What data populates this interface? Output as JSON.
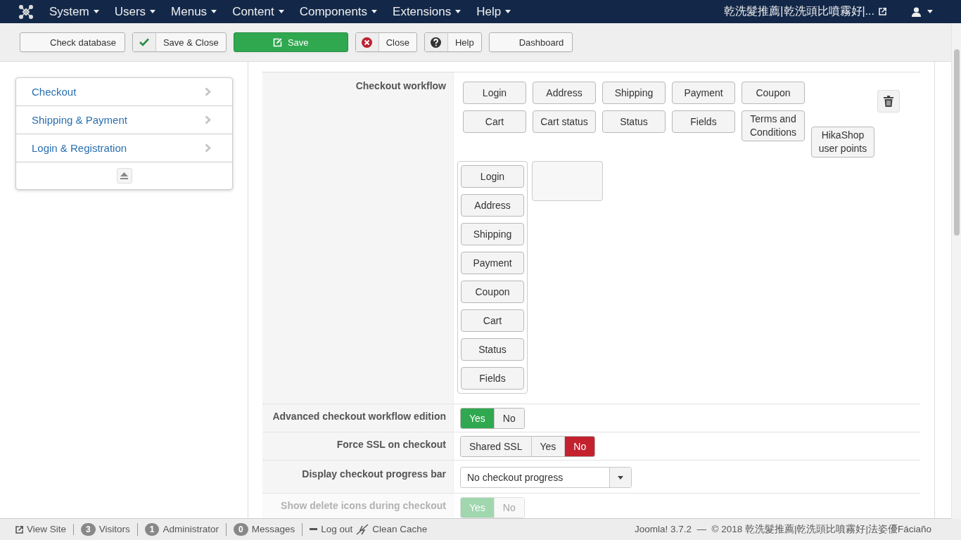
{
  "navbar": {
    "menus": [
      {
        "label": "System"
      },
      {
        "label": "Users"
      },
      {
        "label": "Menus"
      },
      {
        "label": "Content"
      },
      {
        "label": "Components"
      },
      {
        "label": "Extensions"
      },
      {
        "label": "Help"
      }
    ],
    "site_link": "乾洗髮推薦|乾洗頭比噴霧好|..."
  },
  "toolbar": {
    "buttons": [
      {
        "label": "Check database",
        "kind": "plain"
      },
      {
        "label": "Save & Close",
        "kind": "check"
      },
      {
        "label": "Save",
        "kind": "primary"
      },
      {
        "label": "Close",
        "kind": "cancel"
      },
      {
        "label": "Help",
        "kind": "help"
      },
      {
        "label": "Dashboard",
        "kind": "plain"
      }
    ]
  },
  "sidebar": {
    "items": [
      {
        "label": "Checkout"
      },
      {
        "label": "Shipping & Payment"
      },
      {
        "label": "Login & Registration"
      }
    ]
  },
  "settings": [
    {
      "label": "Checkout workflow",
      "kind": "workflow",
      "available": [
        "Login",
        "Address",
        "Shipping",
        "Payment",
        "Coupon",
        "Cart",
        "Cart status",
        "Status",
        "Fields",
        "Terms and Conditions",
        "HikaShop user points"
      ],
      "step": [
        "Login",
        "Address",
        "Shipping",
        "Payment",
        "Coupon",
        "Cart",
        "Status",
        "Fields"
      ]
    },
    {
      "label": "Advanced checkout workflow edition",
      "kind": "toggle",
      "disabled": false,
      "options": [
        {
          "label": "Yes",
          "kind": "yes",
          "selected": true
        },
        {
          "label": "No",
          "kind": "no",
          "selected": false
        }
      ]
    },
    {
      "label": "Force SSL on checkout",
      "kind": "toggle",
      "disabled": false,
      "options": [
        {
          "label": "Shared SSL",
          "kind": "neutral",
          "selected": false
        },
        {
          "label": "Yes",
          "kind": "yes",
          "selected": false
        },
        {
          "label": "No",
          "kind": "no",
          "selected": true
        }
      ]
    },
    {
      "label": "Display checkout progress bar",
      "kind": "select",
      "value": "No checkout progress"
    },
    {
      "label": "Show delete icons during checkout",
      "kind": "toggle",
      "disabled": true,
      "options": [
        {
          "label": "Yes",
          "kind": "yes",
          "selected": true
        },
        {
          "label": "No",
          "kind": "no",
          "selected": false
        }
      ]
    }
  ],
  "status_bar": {
    "view_site": "View Site",
    "counters": [
      {
        "count": "3",
        "label": "Visitors"
      },
      {
        "count": "1",
        "label": "Administrator"
      },
      {
        "count": "0",
        "label": "Messages"
      }
    ],
    "logout": "Log out",
    "clean_cache": "Clean Cache",
    "footer": "Joomla! 3.7.2  —  © 2018 乾洗髮推薦|乾洗頭比噴霧好|法姿優Fáciaño"
  }
}
